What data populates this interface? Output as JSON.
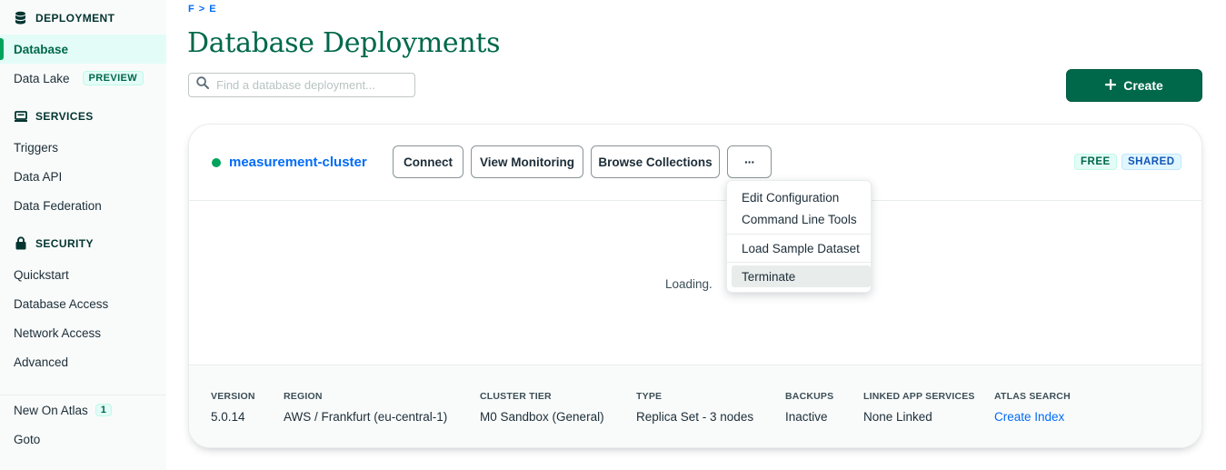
{
  "sidebar": {
    "deployment_header": "DEPLOYMENT",
    "services_header": "SERVICES",
    "security_header": "SECURITY",
    "items": {
      "database": "Database",
      "data_lake": "Data Lake",
      "data_lake_badge": "PREVIEW",
      "triggers": "Triggers",
      "data_api": "Data API",
      "data_federation": "Data Federation",
      "quickstart": "Quickstart",
      "database_access": "Database Access",
      "network_access": "Network Access",
      "advanced": "Advanced",
      "new_on_atlas": "New On Atlas",
      "new_on_atlas_count": "1",
      "goto": "Goto"
    },
    "active_item": "database"
  },
  "header": {
    "breadcrumb": "F > E",
    "title": "Database Deployments",
    "search_placeholder": "Find a database deployment...",
    "create_label": "Create"
  },
  "cluster": {
    "name": "measurement-cluster",
    "status": "active",
    "buttons": {
      "connect": "Connect",
      "view_monitoring": "View Monitoring",
      "browse_collections": "Browse Collections",
      "more": "···"
    },
    "badges": {
      "free": "FREE",
      "shared": "SHARED"
    },
    "loading_text": "Loading.",
    "meta": {
      "version_label": "VERSION",
      "version": "5.0.14",
      "region_label": "REGION",
      "region": "AWS / Frankfurt (eu-central-1)",
      "tier_label": "CLUSTER TIER",
      "tier": "M0 Sandbox (General)",
      "type_label": "TYPE",
      "type": "Replica Set - 3 nodes",
      "backups_label": "BACKUPS",
      "backups": "Inactive",
      "linked_label": "LINKED APP SERVICES",
      "linked": "None Linked",
      "search_label": "ATLAS SEARCH",
      "search": "Create Index"
    }
  },
  "menu": {
    "edit_configuration": "Edit Configuration",
    "command_line_tools": "Command Line Tools",
    "load_sample_dataset": "Load Sample Dataset",
    "terminate": "Terminate",
    "hovered": "terminate"
  },
  "colors": {
    "brand_green": "#00684a",
    "link_blue": "#016bf8",
    "status_green": "#00a35c"
  }
}
